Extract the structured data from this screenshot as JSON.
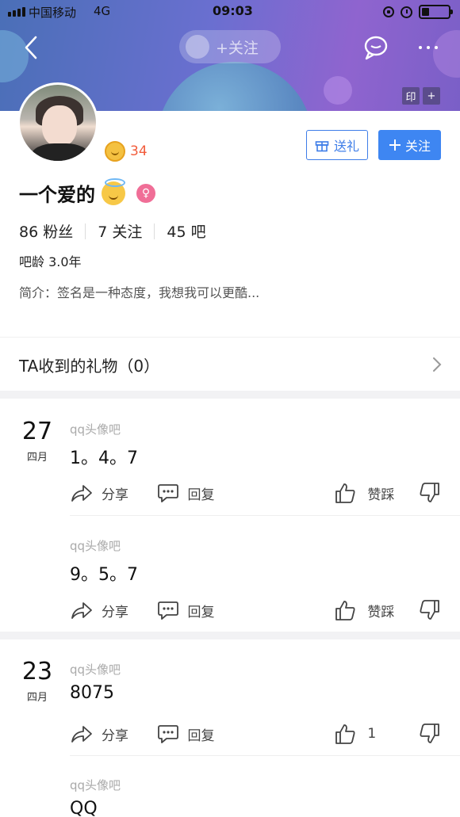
{
  "status_bar": {
    "carrier": "中国移动",
    "network": "4G",
    "time": "09:03"
  },
  "nav": {
    "ghost_follow_label": "+关注",
    "stamp_label": "印",
    "stamp_add_label": "+"
  },
  "profile": {
    "level": "34",
    "gift_button_label": "送礼",
    "follow_button_label": "关注",
    "username": "一个爱的",
    "gender_symbol": "♀",
    "stats": {
      "fans": "86 粉丝",
      "following": "7 关注",
      "bars": "45 吧"
    },
    "bar_age": "吧龄 3.0年",
    "bio": "简介：签名是一种态度，我想我可以更酷..."
  },
  "gifts_row": {
    "label": "TA收到的礼物（0）"
  },
  "feed": [
    {
      "day": "27",
      "month": "四月",
      "posts": [
        {
          "source": "qq头像吧",
          "text": "1。4。7",
          "share": "分享",
          "reply": "回复",
          "vote": "赞踩"
        },
        {
          "source": "qq头像吧",
          "text": "9。5。7",
          "share": "分享",
          "reply": "回复",
          "vote": "赞踩"
        }
      ]
    },
    {
      "day": "23",
      "month": "四月",
      "posts": [
        {
          "source": "qq头像吧",
          "text": "8075",
          "share": "分享",
          "reply": "回复",
          "vote": "1"
        },
        {
          "source": "qq头像吧",
          "text": "QQ"
        }
      ]
    }
  ],
  "colors": {
    "accent": "#3e86f2",
    "level": "#f25c3b",
    "female": "#f06e97"
  }
}
